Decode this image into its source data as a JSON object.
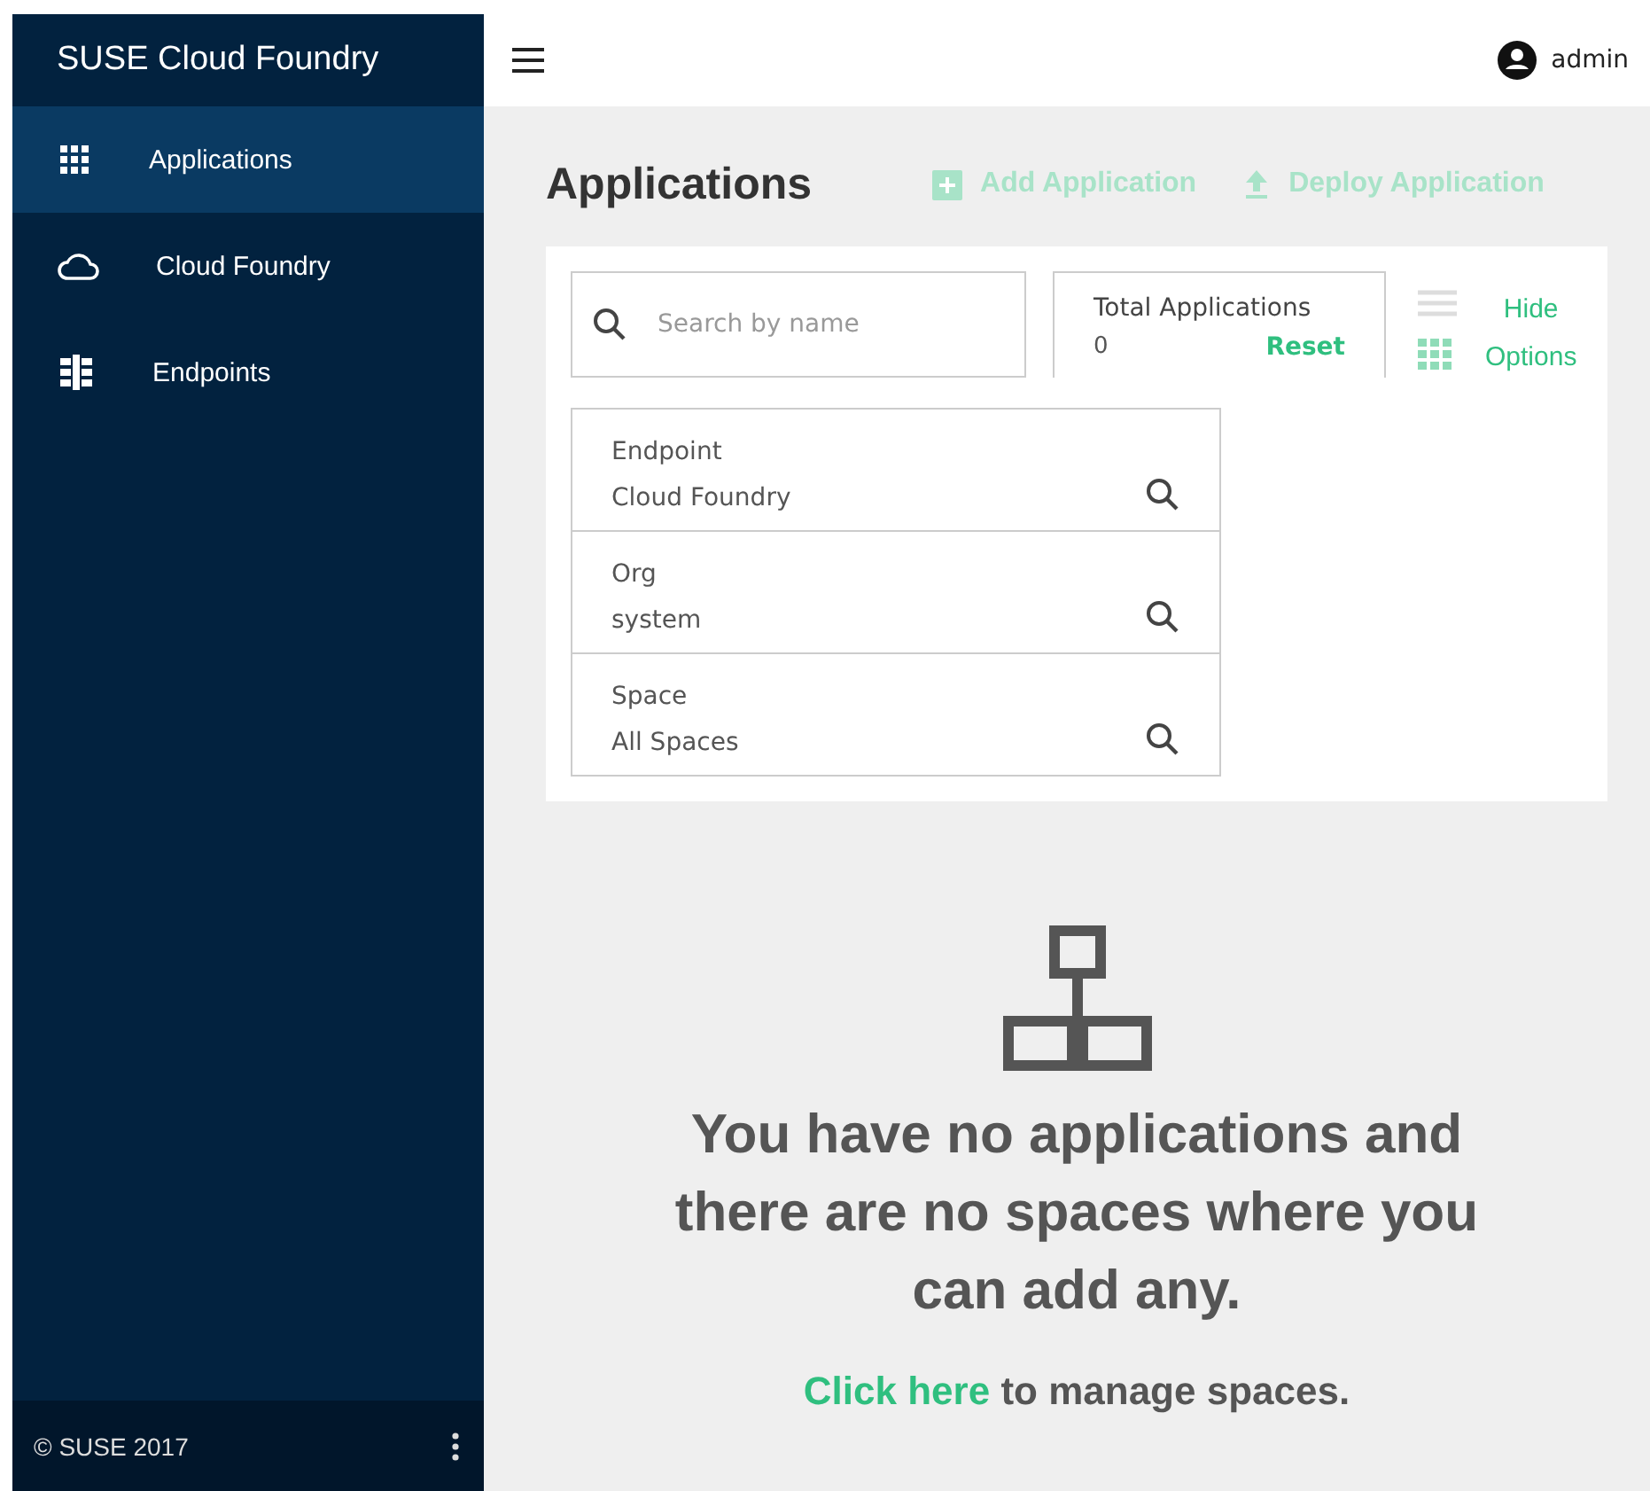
{
  "sidebar": {
    "title": "SUSE Cloud Foundry",
    "items": [
      {
        "label": "Applications",
        "kind": "grid",
        "selected": true
      },
      {
        "label": "Cloud Foundry",
        "kind": "cloud",
        "selected": false
      },
      {
        "label": "Endpoints",
        "kind": "endpoints",
        "selected": false
      }
    ],
    "footer": "© SUSE 2017"
  },
  "header": {
    "user": "admin"
  },
  "page": {
    "title": "Applications",
    "actions": [
      {
        "label": "Add Application",
        "kind": "add",
        "disabled": true
      },
      {
        "label": "Deploy Application",
        "kind": "deploy",
        "disabled": true
      }
    ]
  },
  "filters": {
    "search": {
      "placeholder": "Search by name"
    },
    "total": {
      "label": "Total Applications",
      "value": "0",
      "reset": "Reset"
    },
    "toggle": {
      "line1": "Hide",
      "line2": "Options"
    },
    "fields": [
      {
        "label": "Endpoint",
        "value": "Cloud Foundry"
      },
      {
        "label": "Org",
        "value": "system"
      },
      {
        "label": "Space",
        "value": "All Spaces"
      }
    ]
  },
  "empty": {
    "message": "You have no applications and there are no spaces where you can add any.",
    "link": "Click here",
    "suffix": " to manage spaces."
  }
}
